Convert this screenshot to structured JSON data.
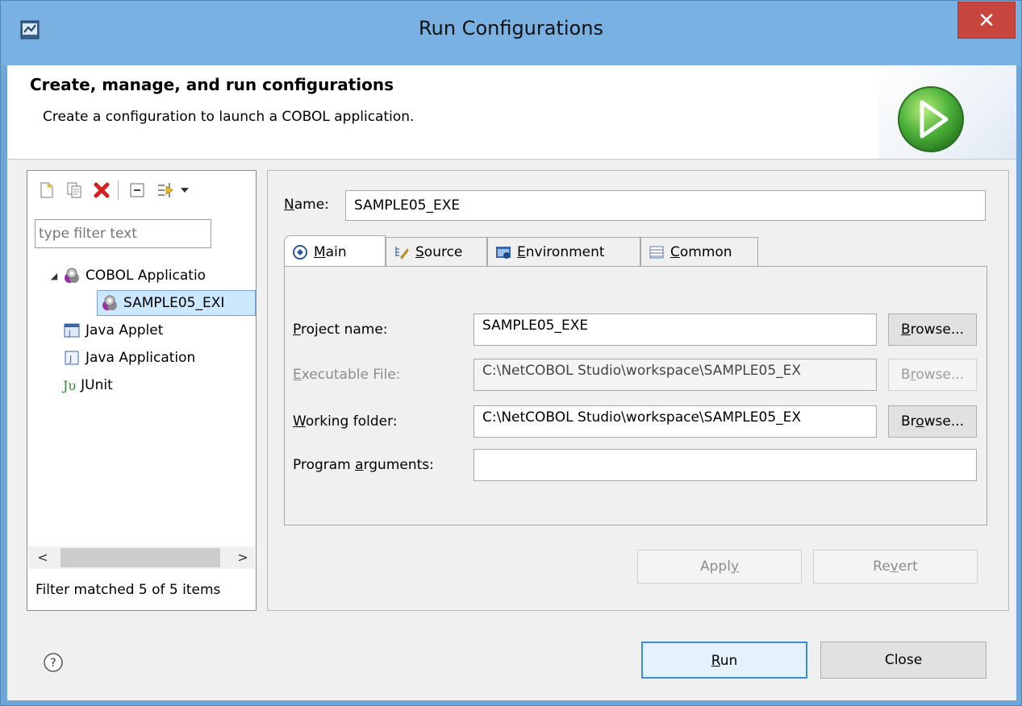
{
  "window": {
    "title": "Run Configurations",
    "close_glyph": "✕"
  },
  "header": {
    "title": "Create, manage, and run configurations",
    "subtitle": "Create a configuration to launch a COBOL application."
  },
  "left_pane": {
    "filter_placeholder": "type filter text",
    "tree": [
      {
        "label": "COBOL Applicatio",
        "level": 0,
        "expanded": true,
        "icon": "cobol-app-icon"
      },
      {
        "label": "SAMPLE05_EXI",
        "level": 1,
        "selected": true,
        "icon": "cobol-config-icon"
      },
      {
        "label": "Java Applet",
        "level": 0,
        "icon": "java-applet-icon"
      },
      {
        "label": "Java Application",
        "level": 0,
        "icon": "java-application-icon"
      },
      {
        "label": "JUnit",
        "level": 0,
        "icon": "junit-icon",
        "icon_text": "Jυ"
      }
    ],
    "scroll_left": "<",
    "scroll_right": ">",
    "status": "Filter matched 5 of 5 items"
  },
  "right_pane": {
    "name_label_pre": "",
    "name_label_u": "N",
    "name_label_post": "ame:",
    "name_value": "SAMPLE05_EXE",
    "tabs": [
      {
        "pre": "",
        "u": "M",
        "post": "ain",
        "active": true
      },
      {
        "pre": "",
        "u": "S",
        "post": "ource"
      },
      {
        "pre": "",
        "u": "E",
        "post": "nvironment"
      },
      {
        "pre": "",
        "u": "C",
        "post": "ommon"
      }
    ],
    "fields": {
      "project": {
        "pre": "",
        "u": "P",
        "post": "roject name:",
        "value": "SAMPLE05_EXE"
      },
      "executable": {
        "pre": "",
        "u": "E",
        "post": "xecutable File:",
        "value": "C:\\NetCOBOL Studio\\workspace\\SAMPLE05_EX"
      },
      "working": {
        "pre": "",
        "u": "W",
        "post": "orking folder:",
        "value": "C:\\NetCOBOL Studio\\workspace\\SAMPLE05_EX"
      },
      "arguments": {
        "pre": "Program ",
        "u": "a",
        "post": "rguments:",
        "value": ""
      }
    },
    "browse": [
      {
        "pre": "",
        "u": "B",
        "post": "rowse..."
      },
      {
        "pre": "B",
        "u": "r",
        "post": "owse..."
      },
      {
        "pre": "Br",
        "u": "o",
        "post": "wse..."
      }
    ],
    "apply": {
      "pre": "Appl",
      "u": "y",
      "post": ""
    },
    "revert": {
      "pre": "Re",
      "u": "v",
      "post": "ert"
    }
  },
  "footer": {
    "run": {
      "pre": "",
      "u": "R",
      "post": "un"
    },
    "close": "Close",
    "help_glyph": "?"
  },
  "colors": {
    "accent": "#3c8cd4",
    "selection": "#cce8ff",
    "delete_red": "#d42020",
    "run_green": "#3aa33a"
  }
}
